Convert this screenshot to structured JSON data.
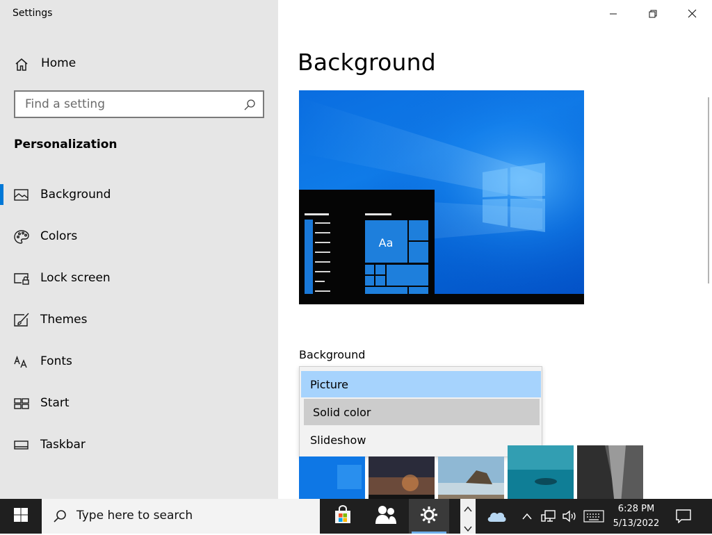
{
  "app": {
    "title": "Settings"
  },
  "window_controls": {
    "minimize_icon": "minimize-icon",
    "restore_icon": "restore-icon",
    "close_icon": "close-icon"
  },
  "sidebar": {
    "home_label": "Home",
    "search_placeholder": "Find a setting",
    "section": "Personalization",
    "items": [
      {
        "label": "Background",
        "icon": "picture-icon",
        "active": true
      },
      {
        "label": "Colors",
        "icon": "palette-icon"
      },
      {
        "label": "Lock screen",
        "icon": "lock-screen-icon"
      },
      {
        "label": "Themes",
        "icon": "themes-brush-icon"
      },
      {
        "label": "Fonts",
        "icon": "fonts-icon"
      },
      {
        "label": "Start",
        "icon": "start-layout-icon"
      },
      {
        "label": "Taskbar",
        "icon": "taskbar-icon"
      }
    ]
  },
  "main": {
    "title": "Background",
    "preview": {
      "tile_text": "Aa"
    },
    "background_field": {
      "label": "Background",
      "selected": "Picture",
      "options": [
        "Picture",
        "Solid color",
        "Slideshow"
      ]
    },
    "thumbnails": [
      "blue-windows",
      "night-sky",
      "beach-rocks",
      "underwater-diver",
      "rock-cliff"
    ]
  },
  "taskbar": {
    "search_placeholder": "Type here to search",
    "time": "6:28 PM",
    "date": "5/13/2022",
    "accent": "#6fb0ec"
  },
  "colors": {
    "accent": "#0078d7",
    "sidebar_bg": "#e6e6e6",
    "selected_option": "#a6d3fd",
    "hover_option": "#cccccc"
  }
}
